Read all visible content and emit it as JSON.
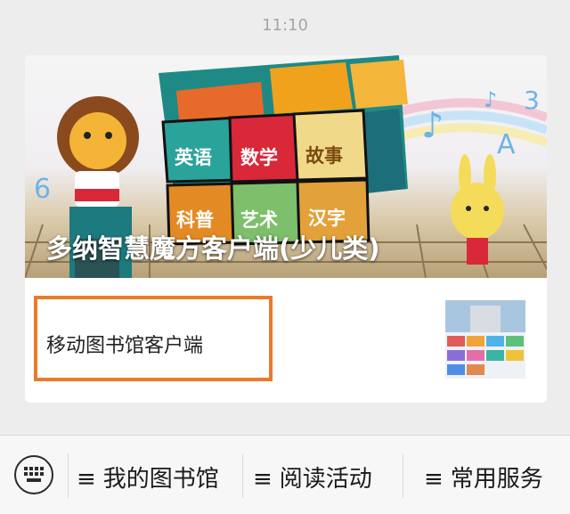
{
  "status_bar": {
    "time": "11:10"
  },
  "article": {
    "title": "多纳智慧魔方客户端(少儿类)",
    "cube_labels": [
      "英语",
      "数学",
      "故事",
      "科普",
      "艺术",
      "汉字"
    ],
    "sub_item_title": "移动图书馆客户端"
  },
  "menu": {
    "keyboard_icon": "keyboard-icon",
    "items": [
      {
        "prefix": "≡",
        "label": "我的图书馆"
      },
      {
        "prefix": "≡",
        "label": "阅读活动"
      },
      {
        "prefix": "≡",
        "label": "常用服务"
      }
    ]
  },
  "colors": {
    "highlight": "#ec7a2c"
  }
}
